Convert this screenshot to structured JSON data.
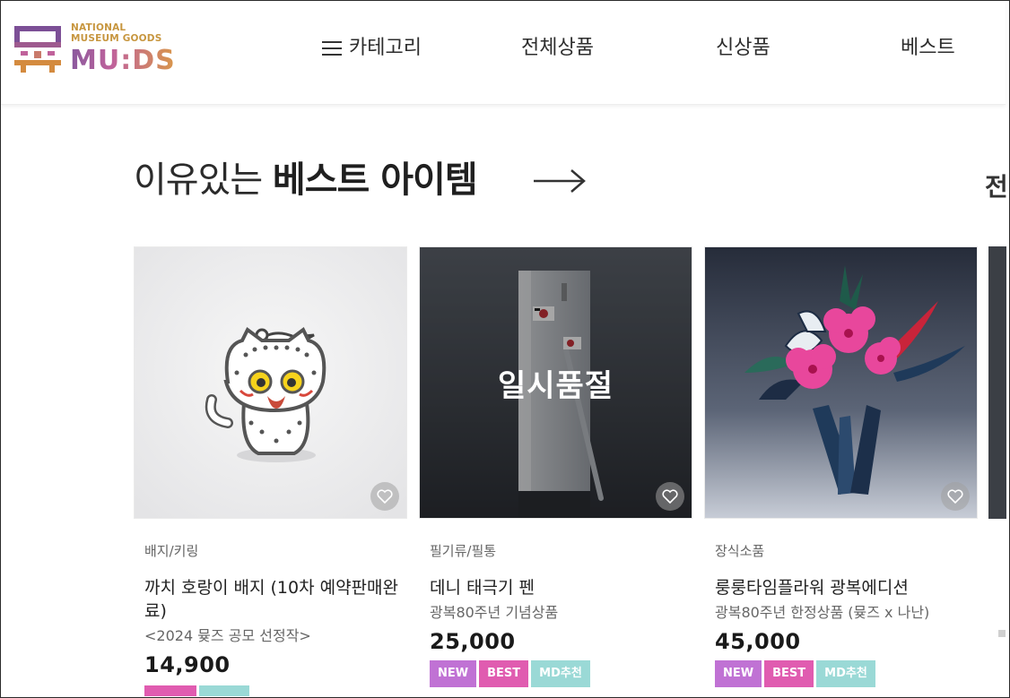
{
  "header": {
    "logo_small_line1": "NATIONAL",
    "logo_small_line2": "MUSEUM GOODS",
    "logo_big": "MU:DS",
    "nav": {
      "category": "카테고리",
      "all_products": "전체상품",
      "new_products": "신상품",
      "best": "베스트"
    }
  },
  "section": {
    "title_light": "이유있는 ",
    "title_bold": "베스트 아이템",
    "peek_text": "전"
  },
  "products": [
    {
      "category": "배지/키링",
      "name": "까치 호랑이 배지 (10차 예약판매완료)",
      "subtitle": "<2024 뮺즈 공모 선정작>",
      "price": "14,900",
      "sold_out": false,
      "badges": []
    },
    {
      "category": "필기류/필통",
      "name": "데니 태극기 펜",
      "subtitle": "광복80주년 기념상품",
      "price": "25,000",
      "sold_out": true,
      "sold_out_label": "일시품절",
      "badges": [
        "NEW",
        "BEST",
        "MD추천"
      ]
    },
    {
      "category": "장식소품",
      "name": "룽룽타임플라워 광복에디션",
      "subtitle": "광복80주년 한정상품 (뮺즈 x 나난)",
      "price": "45,000",
      "sold_out": false,
      "badges": [
        "NEW",
        "BEST",
        "MD추천"
      ]
    }
  ],
  "colors": {
    "badge_new": "#c072d4",
    "badge_best": "#e05cb0",
    "badge_md": "#9ad9d6",
    "logo_gold": "#c7963f",
    "logo_purple": "#8a5a9e"
  },
  "icons": {
    "menu": "hamburger-icon",
    "arrow": "arrow-right-icon",
    "wishlist": "heart-icon"
  }
}
